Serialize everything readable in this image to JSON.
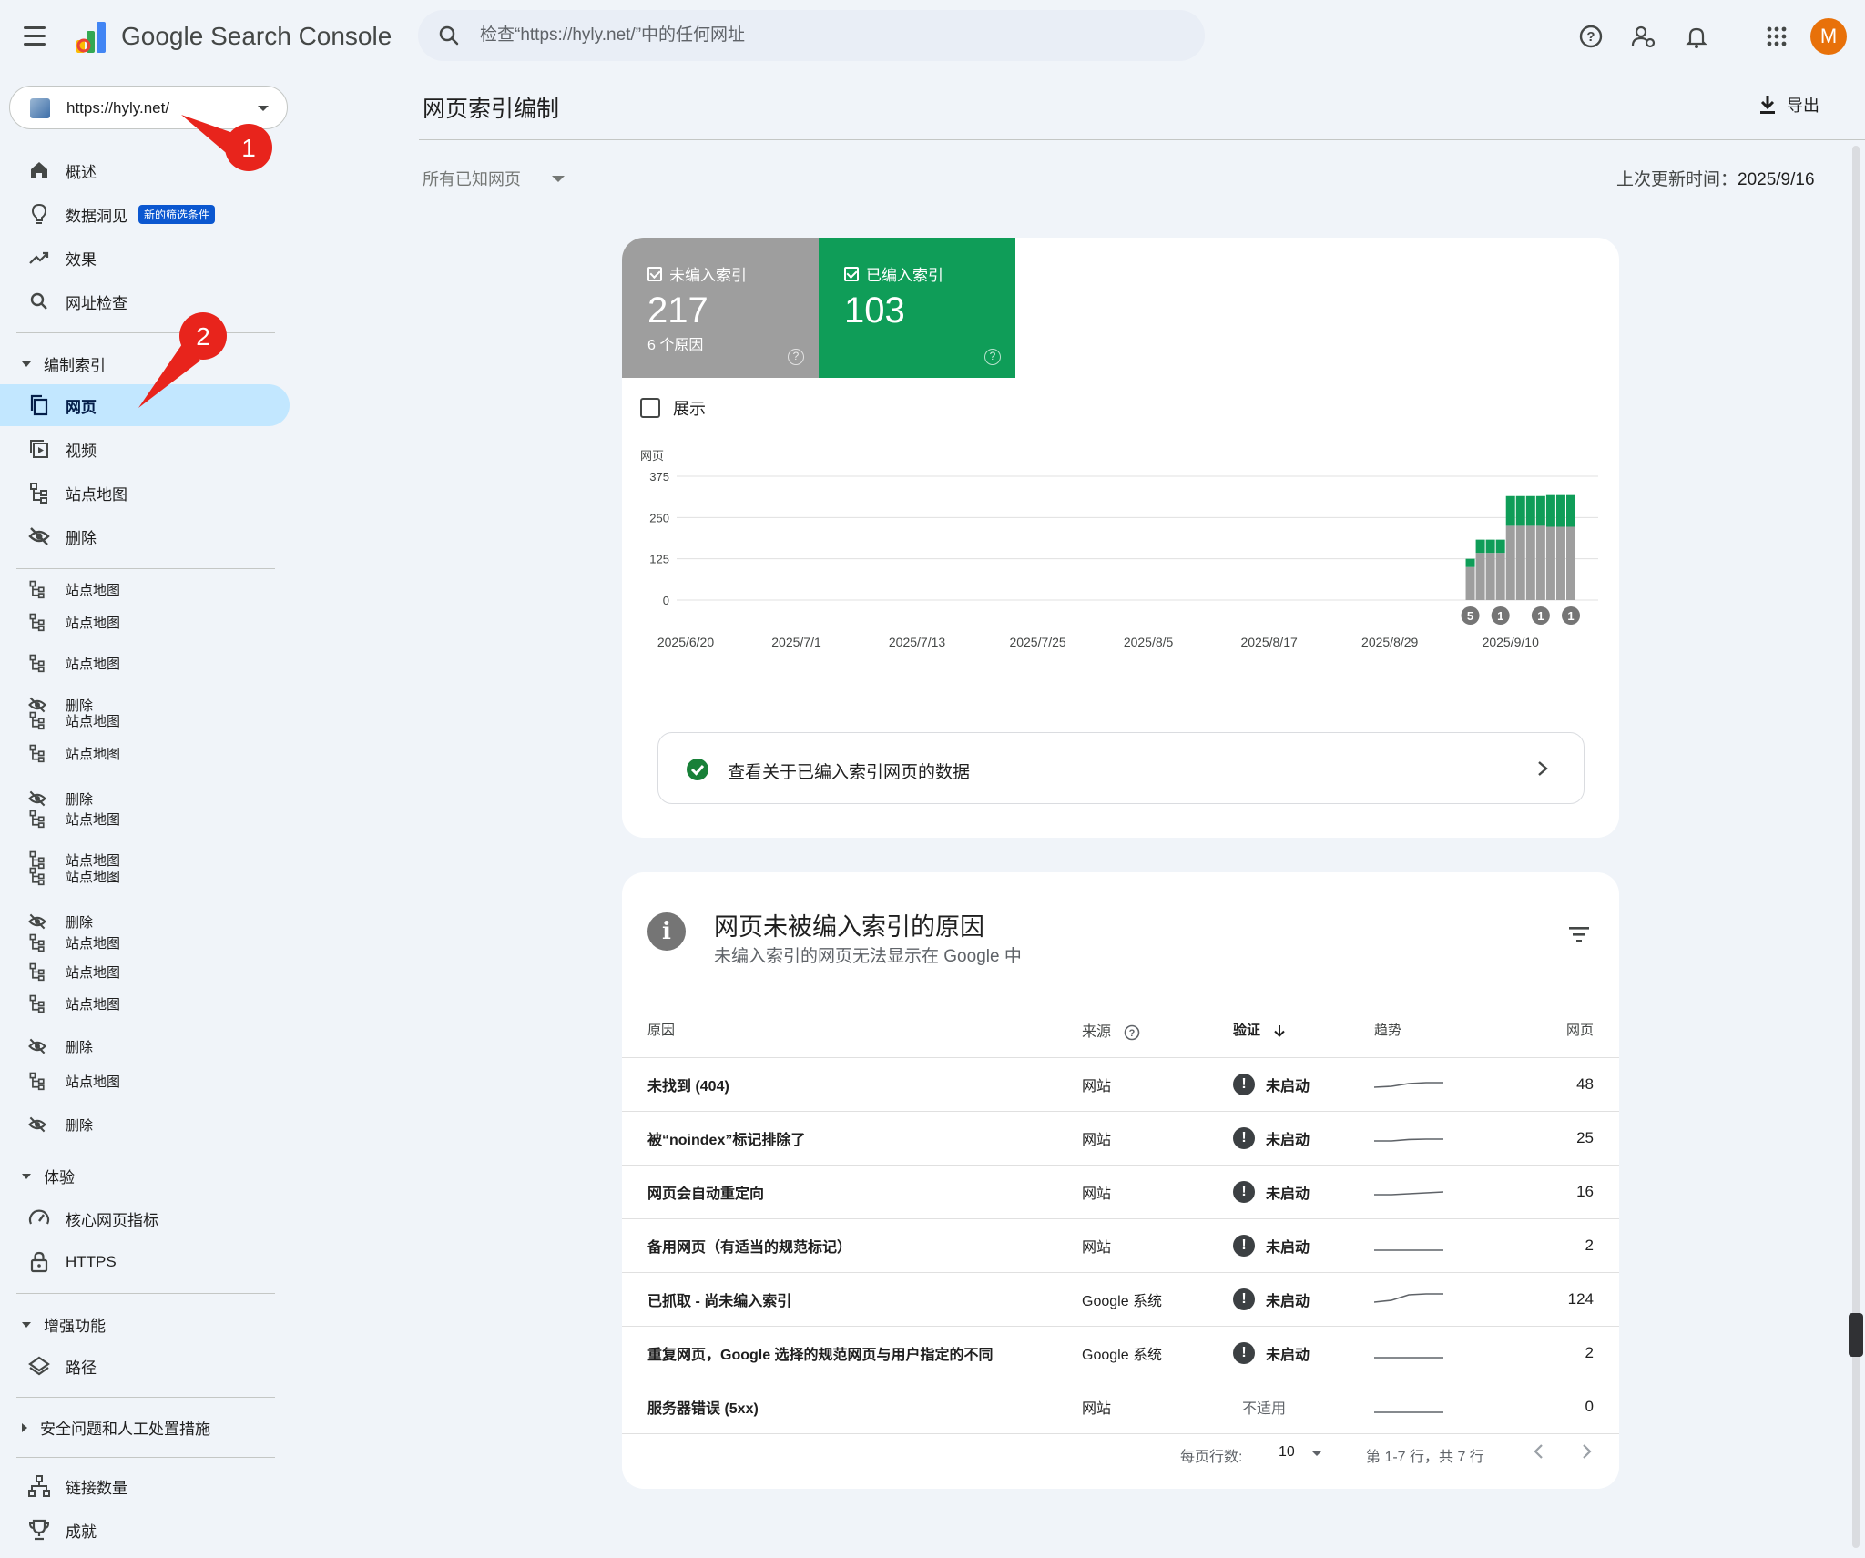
{
  "app": {
    "title": "Google Search Console",
    "user_initial": "M"
  },
  "search": {
    "placeholder": "检查“https://hyly.net/”中的任何网址"
  },
  "property": {
    "url": "https://hyly.net/"
  },
  "sidebar": {
    "overview": "概述",
    "insights": "数据洞见",
    "insights_badge": "新的筛选条件",
    "performance": "效果",
    "url_inspection": "网址检查",
    "indexing_section": "编制索引",
    "pages": "网页",
    "videos": "视频",
    "sitemaps": "站点地图",
    "removals": "删除",
    "ghost_items": [
      "站点地图",
      "站点地图",
      "站点地图",
      "删除",
      "站点地图",
      "站点地图",
      "删除",
      "站点地图",
      "站点地图",
      "站点地图",
      "删除",
      "站点地图",
      "站点地图",
      "站点地图",
      "删除",
      "站点地图",
      "删除"
    ],
    "experience_section": "体验",
    "core_web_vitals": "核心网页指标",
    "https": "HTTPS",
    "enhancements_section": "增强功能",
    "breadcrumbs": "路径",
    "security_section": "安全问题和人工处置措施",
    "links": "链接数量",
    "achievements": "成就"
  },
  "annotations": {
    "marker1": "1",
    "marker2": "2"
  },
  "main": {
    "title": "网页索引编制",
    "export": "导出",
    "filter": "所有已知网页",
    "last_updated_label": "上次更新时间：",
    "last_updated_value": "2025/9/16"
  },
  "summary": {
    "not_indexed_label": "未编入索引",
    "not_indexed_count": "217",
    "not_indexed_sub": "6 个原因",
    "indexed_label": "已编入索引",
    "indexed_count": "103",
    "show_label": "展示",
    "detail_link": "查看关于已编入索引网页的数据"
  },
  "colors": {
    "not_indexed": "#9e9e9e",
    "indexed": "#0f9d58",
    "accent": "#0b57d0"
  },
  "chart_data": {
    "type": "bar",
    "ylabel": "网页",
    "ylim": [
      0,
      375
    ],
    "yticks": [
      0,
      125,
      250,
      375
    ],
    "x_tick_labels": [
      "2025/6/20",
      "2025/7/1",
      "2025/7/13",
      "2025/7/25",
      "2025/8/5",
      "2025/8/17",
      "2025/8/29",
      "2025/9/10"
    ],
    "x": [
      "2025/9/6",
      "2025/9/7",
      "2025/9/8",
      "2025/9/9",
      "2025/9/10",
      "2025/9/11",
      "2025/9/12",
      "2025/9/13",
      "2025/9/14",
      "2025/9/15",
      "2025/9/16"
    ],
    "x_range": [
      "2025/6/20",
      "2025/9/16"
    ],
    "series": [
      {
        "name": "未编入索引",
        "values": [
          100,
          143,
          143,
          143,
          225,
          225,
          225,
          225,
          222,
          222,
          222
        ]
      },
      {
        "name": "已编入索引",
        "values": [
          25,
          40,
          40,
          40,
          90,
          90,
          90,
          90,
          96,
          96,
          96
        ]
      }
    ],
    "annotations": [
      {
        "x": "2025/9/6",
        "label": "5"
      },
      {
        "x": "2025/9/9",
        "label": "1"
      },
      {
        "x": "2025/9/13",
        "label": "1"
      },
      {
        "x": "2025/9/16",
        "label": "1"
      }
    ]
  },
  "reasons": {
    "title": "网页未被编入索引的原因",
    "subtitle": "未编入索引的网页无法显示在 Google 中",
    "headers": {
      "reason": "原因",
      "source": "来源",
      "validation": "验证",
      "trend": "趋势",
      "pages": "网页"
    },
    "rows": [
      {
        "reason": "未找到 (404)",
        "source": "网站",
        "validation": "未启动",
        "pages": "48",
        "trend": [
          0.2,
          0.25,
          0.4,
          0.45,
          0.45
        ]
      },
      {
        "reason": "被“noindex”标记排除了",
        "source": "网站",
        "validation": "未启动",
        "pages": "25",
        "trend": [
          0.2,
          0.2,
          0.28,
          0.3,
          0.3
        ]
      },
      {
        "reason": "网页会自动重定向",
        "source": "网站",
        "validation": "未启动",
        "pages": "16",
        "trend": [
          0.2,
          0.2,
          0.25,
          0.3,
          0.35
        ]
      },
      {
        "reason": "备用网页（有适当的规范标记）",
        "source": "网站",
        "validation": "未启动",
        "pages": "2",
        "trend": [
          0.1,
          0.1,
          0.1,
          0.1,
          0.1
        ]
      },
      {
        "reason": "已抓取 - 尚未编入索引",
        "source": "Google 系统",
        "validation": "未启动",
        "pages": "124",
        "trend": [
          0.2,
          0.3,
          0.6,
          0.65,
          0.65
        ]
      },
      {
        "reason": "重复网页，Google 选择的规范网页与用户指定的不同",
        "source": "Google 系统",
        "validation": "未启动",
        "pages": "2",
        "trend": [
          0.1,
          0.1,
          0.1,
          0.1,
          0.1
        ]
      },
      {
        "reason": "服务器错误 (5xx)",
        "source": "网站",
        "validation": "不适用",
        "pages": "0",
        "trend": [
          0.05,
          0.05,
          0.05,
          0.05,
          0.05
        ]
      }
    ],
    "pager": {
      "rows_per_page_label": "每页行数:",
      "rows_per_page": "10",
      "range": "第 1-7 行，共 7 行"
    }
  }
}
